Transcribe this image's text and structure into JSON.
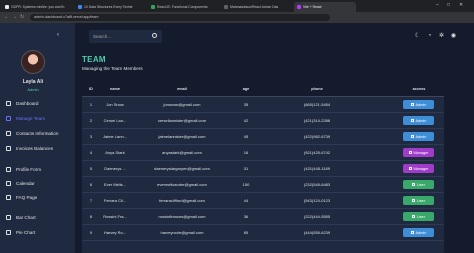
{
  "browser": {
    "tabs": [
      {
        "label": "GDPR: Systems misfire: you and th",
        "color": "#e8eaed"
      },
      {
        "label": "10 Data Structures Every Techie",
        "color": "#4285f4"
      },
      {
        "label": "ReactJS: Functional Components",
        "color": "#34a853"
      },
      {
        "label": "Mahmadalsoz/React Admin Das",
        "color": "#24292e"
      },
      {
        "label": "Vite + React",
        "color": "#bd34fe"
      }
    ],
    "url": "admin-dashboard-x7a8f.vercel.app/team"
  },
  "sidebar": {
    "user_name": "Layla Ali",
    "user_role": "Admin",
    "items": [
      {
        "label": "Dashboard",
        "icon": "home-icon"
      },
      {
        "label": "Manage Team",
        "icon": "people-icon",
        "active": true
      },
      {
        "label": "Contacts Information",
        "icon": "contacts-icon"
      },
      {
        "label": "Invoices Balances",
        "icon": "receipt-icon"
      },
      {
        "label": "Profile Form",
        "icon": "person-icon"
      },
      {
        "label": "Calendar",
        "icon": "calendar-icon"
      },
      {
        "label": "FAQ Page",
        "icon": "help-icon"
      },
      {
        "label": "Bar Chart",
        "icon": "bar-chart-icon"
      },
      {
        "label": "Pie Chart",
        "icon": "pie-chart-icon"
      }
    ]
  },
  "search": {
    "placeholder": "Search..."
  },
  "page": {
    "title": "TEAM",
    "subtitle": "Managing the Team Members"
  },
  "table": {
    "columns": [
      "ID",
      "name",
      "email",
      "age",
      "phone",
      "access"
    ],
    "rows": [
      {
        "id": "1",
        "name": "Jon Snow",
        "email": "jonsnow@gmail.com",
        "age": "35",
        "phone": "(665)121-5454",
        "access": "Admin"
      },
      {
        "id": "2",
        "name": "Cersei Lan...",
        "email": "cerseilannister@gmail.com",
        "age": "42",
        "phone": "(421)314-2288",
        "access": "Admin"
      },
      {
        "id": "3",
        "name": "Jaime Lann...",
        "email": "jaimelannister@gmail.com",
        "age": "45",
        "phone": "(422)982-6739",
        "access": "Admin"
      },
      {
        "id": "4",
        "name": "Anya Stark",
        "email": "anyastark@gmail.com",
        "age": "16",
        "phone": "(921)425-6742",
        "access": "Manager"
      },
      {
        "id": "5",
        "name": "Daenerys ...",
        "email": "daenerystargaryen@gmail.com",
        "age": "31",
        "phone": "(421)445-1189",
        "access": "Manager"
      },
      {
        "id": "6",
        "name": "Ever Melis...",
        "email": "evermelisandre@gmail.com",
        "age": "150",
        "phone": "(232)545-6483",
        "access": "User"
      },
      {
        "id": "7",
        "name": "Ferrara Cli...",
        "email": "ferraraclifford@gmail.com",
        "age": "44",
        "phone": "(543)124-0123",
        "access": "User"
      },
      {
        "id": "8",
        "name": "Rossini Fra...",
        "email": "rossinifrances@gmail.com",
        "age": "36",
        "phone": "(222)444-5555",
        "access": "User"
      },
      {
        "id": "9",
        "name": "Harvey Ro...",
        "email": "harveyroxie@gmail.com",
        "age": "65",
        "phone": "(444)555-6239",
        "access": "Admin"
      }
    ]
  },
  "colors": {
    "accent": "#4cceac",
    "admin": "#3e8ed7",
    "manager": "#a03cc9",
    "user": "#3aa86b"
  }
}
